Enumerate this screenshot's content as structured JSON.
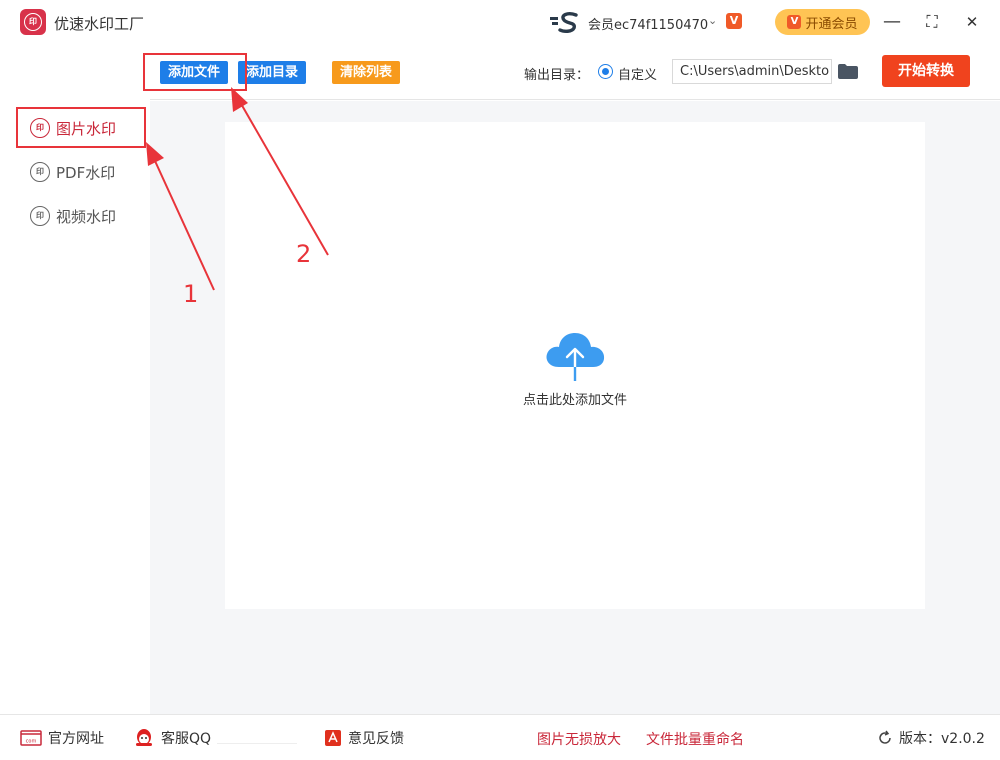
{
  "window": {
    "title": "优速水印工厂",
    "user_name": "会员ec74f1150470",
    "vip_label": "开通会员",
    "minimize": "—",
    "maximize": "⛶",
    "close": "✕"
  },
  "toolbar": {
    "add_file": "添加文件",
    "add_dir": "添加目录",
    "clear_list": "清除列表",
    "output_label": "输出目录：",
    "radio_label": "自定义",
    "output_path": "C:\\Users\\admin\\Deskto",
    "start": "开始转换"
  },
  "sidebar": {
    "items": [
      {
        "label": "图片水印",
        "icon": "印"
      },
      {
        "label": "PDF水印",
        "icon": "印"
      },
      {
        "label": "视频水印",
        "icon": "印"
      }
    ]
  },
  "main": {
    "drop_text": "点击此处添加文件"
  },
  "footer": {
    "website": "官方网址",
    "qq": "客服QQ",
    "feedback": "意见反馈",
    "link1": "图片无损放大",
    "link2": "文件批量重命名",
    "version": "版本：v2.0.2"
  },
  "annotations": {
    "num1": "1",
    "num2": "2"
  },
  "colors": {
    "brand": "#d8324a",
    "add_file_btn": "#1e7ee8",
    "clear_btn": "#f79a1c",
    "start_btn": "#f0431e",
    "annotation": "#e8343a"
  }
}
